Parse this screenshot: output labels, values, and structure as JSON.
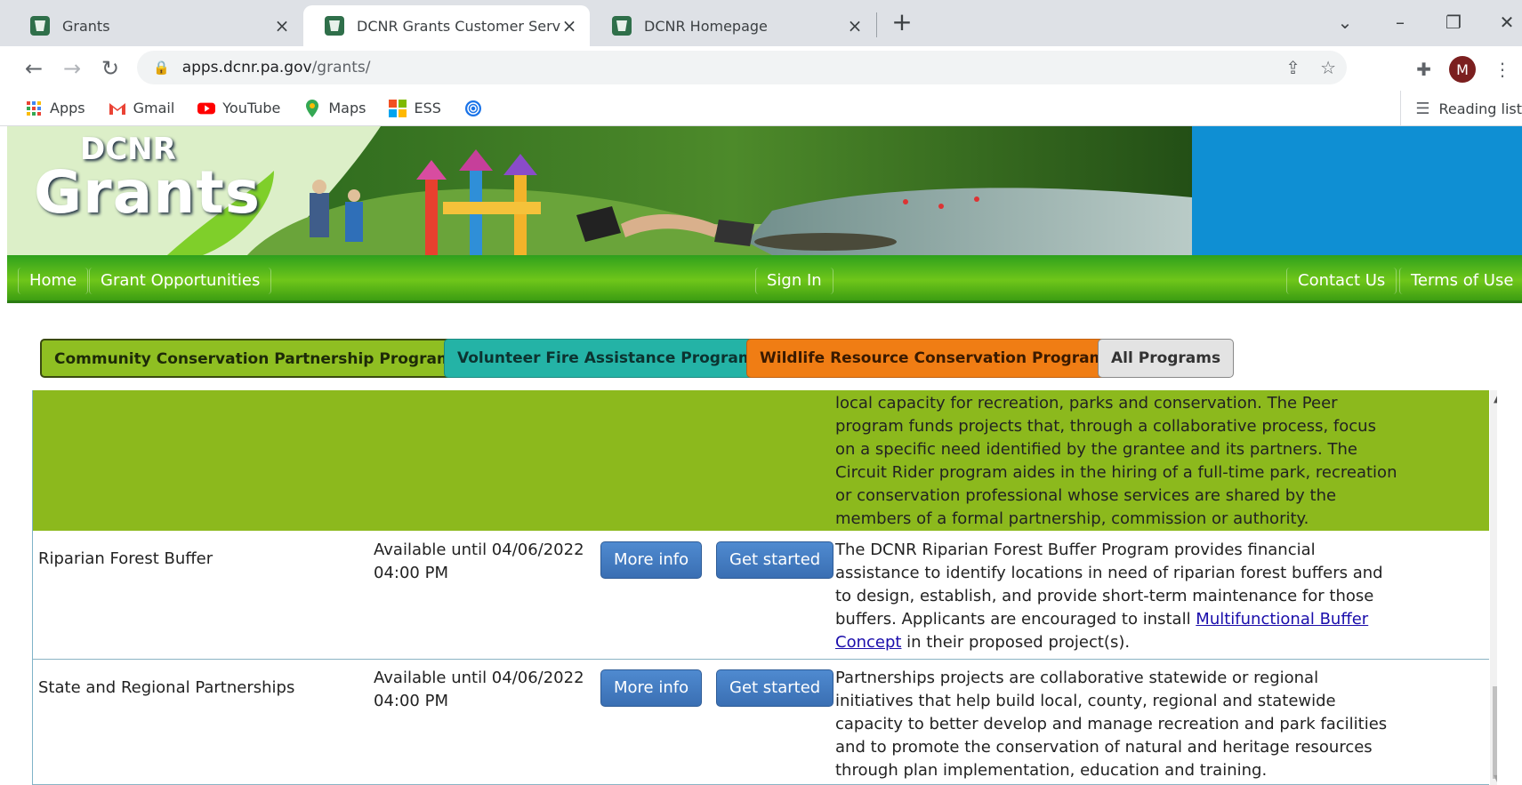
{
  "browser": {
    "tabs": [
      {
        "title": "Grants",
        "active": false
      },
      {
        "title": "DCNR Grants Customer Service P",
        "active": true
      },
      {
        "title": "DCNR Homepage",
        "active": false
      }
    ],
    "address": {
      "host": "apps.dcnr.pa.gov",
      "path": "/grants/"
    },
    "profile_initial": "M",
    "bookmarks": [
      "Apps",
      "Gmail",
      "YouTube",
      "Maps",
      "ESS"
    ],
    "reading_list": "Reading list"
  },
  "site": {
    "logo_top": "DCNR",
    "logo_bottom": "Grants",
    "nav": {
      "home": "Home",
      "opportunities": "Grant Opportunities",
      "sign_in": "Sign In",
      "contact": "Contact Us",
      "terms": "Terms of Use"
    },
    "programs": {
      "ccp": "Community Conservation Partnership Program",
      "vfa": "Volunteer Fire Assistance Program",
      "wrc": "Wildlife Resource Conservation Program",
      "all": "All Programs"
    },
    "colors": {
      "ccp": "#8fbf22",
      "vfa": "#24b3a6",
      "wrc": "#f07d14",
      "nav_green": "#4fb31a"
    }
  },
  "table": {
    "green_row_desc": "local capacity for recreation, parks and conservation. The Peer program funds projects that, through a collaborative process, focus on a specific need identified by the grantee and its partners. The Circuit Rider program aides in the hiring of a full-time park, recreation or conservation professional whose services are shared by the members of a formal partnership, commission or authority.",
    "rows": [
      {
        "name": "Riparian Forest Buffer",
        "availability": "Available until 04/06/2022 04:00 PM",
        "more_info": "More info",
        "get_started": "Get started",
        "desc_before": "The DCNR Riparian Forest Buffer Program provides financial assistance to identify locations in need of riparian forest buffers and to design, establish, and provide short-term maintenance for those buffers. Applicants are encouraged to install ",
        "desc_link": "Multifunctional Buffer Concept",
        "desc_after": " in their proposed project(s)."
      },
      {
        "name": "State and Regional Partnerships",
        "availability": "Available until 04/06/2022 04:00 PM",
        "more_info": "More info",
        "get_started": "Get started",
        "desc": "Partnerships projects are collaborative statewide or regional initiatives that help build local, county, regional and statewide capacity to better develop and manage recreation and park facilities and to promote the conservation of natural and heritage resources through plan implementation, education and training."
      }
    ]
  }
}
